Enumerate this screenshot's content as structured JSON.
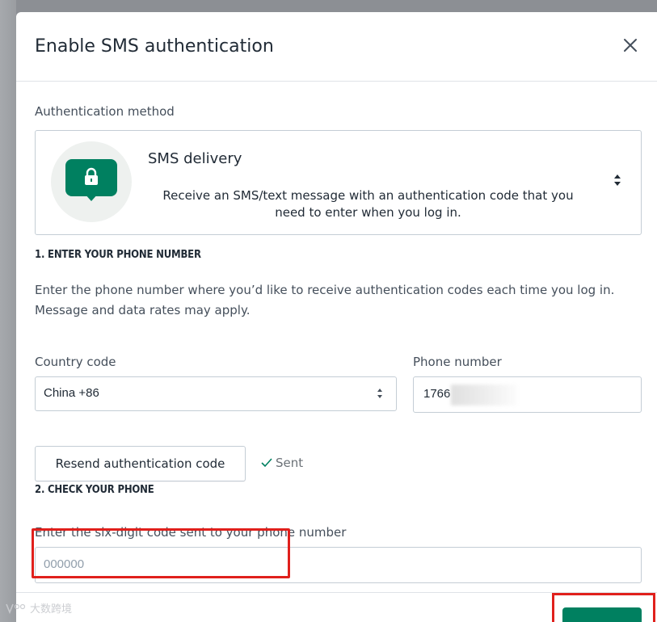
{
  "modal": {
    "title": "Enable SMS authentication",
    "close_icon": "close-icon"
  },
  "method": {
    "label": "Authentication method",
    "name": "SMS delivery",
    "description": "Receive an SMS/text message with an authentication code that you need to enter when you log in.",
    "icon": "lock-message-icon",
    "select_icon": "select-arrows-icon"
  },
  "step1": {
    "heading": "1. ENTER YOUR PHONE NUMBER",
    "paragraph": "Enter the phone number where you’d like to receive authentication codes each time you log in. Message and data rates may apply.",
    "country_label": "Country code",
    "country_value": "China +86",
    "phone_label": "Phone number",
    "phone_value": "1766"
  },
  "resend": {
    "button_label": "Resend authentication code",
    "sent_label": "Sent",
    "sent_icon": "check-icon"
  },
  "step2": {
    "heading": "2. CHECK YOUR PHONE",
    "code_label": "Enter the six-digit code sent to your phone number",
    "code_placeholder": "000000"
  },
  "watermark": {
    "text": "大数跨境"
  },
  "colors": {
    "primary": "#008060",
    "highlight": "#e0201c"
  }
}
